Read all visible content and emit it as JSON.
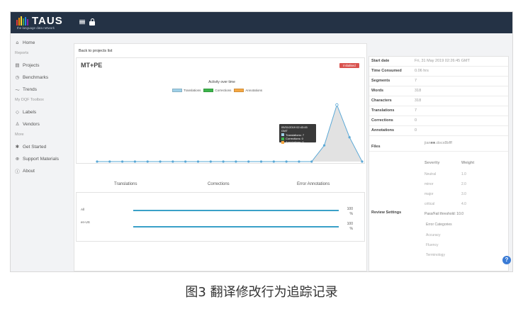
{
  "app": {
    "logo_text": "TAUS",
    "logo_tagline": "the language data network",
    "logo_bar_colors": [
      "#e53935",
      "#fb8c00",
      "#fdd835",
      "#43a047",
      "#1e88e5",
      "#8e24aa"
    ]
  },
  "sidebar": {
    "home": {
      "label": "Home",
      "icon": "home-icon"
    },
    "reports_section": "Reports",
    "items": [
      {
        "label": "Projects",
        "icon": "projects-icon"
      },
      {
        "label": "Benchmarks",
        "icon": "benchmarks-icon"
      },
      {
        "label": "Trends",
        "icon": "trends-icon"
      }
    ],
    "toolbox_section": "My DQF Toolbox",
    "toolbox_items": [
      {
        "label": "Labels",
        "icon": "label-icon"
      },
      {
        "label": "Vendors",
        "icon": "vendor-icon"
      }
    ],
    "more_section": "More",
    "more_items": [
      {
        "label": "Get Started",
        "icon": "gear-icon"
      },
      {
        "label": "Support Materials",
        "icon": "support-icon"
      },
      {
        "label": "About",
        "icon": "info-icon"
      }
    ]
  },
  "main": {
    "back_link": "Back to projects list",
    "project_title": "MT+PE",
    "status_badge": "Initialised",
    "status_color": "#d9534f"
  },
  "chart_data": {
    "type": "area",
    "title": "Activity over time",
    "legend": [
      {
        "name": "Translations",
        "color": "#9fd0e8"
      },
      {
        "name": "Corrections",
        "color": "#3cb44b"
      },
      {
        "name": "Annotations",
        "color": "#f5a742"
      }
    ],
    "series": [
      {
        "name": "Translations",
        "values": [
          0,
          0,
          0,
          0,
          0,
          0,
          0,
          0,
          0,
          0,
          0,
          0,
          0,
          0,
          0,
          0,
          0,
          0,
          2,
          7,
          3,
          0
        ]
      }
    ],
    "tooltip": {
      "date": "05/31/2019 02:43:45 GMT",
      "lines": [
        "Translations: 7",
        "Corrections: 0",
        "Annotations: 0"
      ]
    }
  },
  "tabs": [
    "Translations",
    "Corrections",
    "Error Annotations"
  ],
  "progress": [
    {
      "label": "All",
      "percent": 100,
      "pct_text": "100 %"
    },
    {
      "label": "en-US",
      "percent": 100,
      "pct_text": "100 %"
    }
  ],
  "info": {
    "rows": [
      {
        "label": "Start date",
        "value": "Fri, 31 May 2019 02:26:45 GMT"
      },
      {
        "label": "Time Consumed",
        "value": "0.06 hrs"
      },
      {
        "label": "Segments",
        "value": "7"
      },
      {
        "label": "Words",
        "value": "318"
      },
      {
        "label": "Characters",
        "value": "318"
      },
      {
        "label": "Translations",
        "value": "7"
      },
      {
        "label": "Corrections",
        "value": "0"
      },
      {
        "label": "Annotations",
        "value": "0"
      }
    ],
    "files_label": "Files",
    "files_value": "jian■■.docx8bfff",
    "review_label": "Review Settings",
    "severity_header": "Severity",
    "weight_header": "Weight",
    "severities": [
      {
        "name": "Neutral",
        "weight": "1.0"
      },
      {
        "name": "minor",
        "weight": "2.0"
      },
      {
        "name": "major",
        "weight": "3.0"
      },
      {
        "name": "critical",
        "weight": "4.0"
      }
    ],
    "threshold_text": "Pass/Fail threshold: 10.0",
    "error_categories_header": "Error Categories",
    "error_categories": [
      "Accuracy",
      "Fluency",
      "Terminology"
    ]
  },
  "help_label": "?",
  "caption": "图3 翻译修改行为追踪记录"
}
